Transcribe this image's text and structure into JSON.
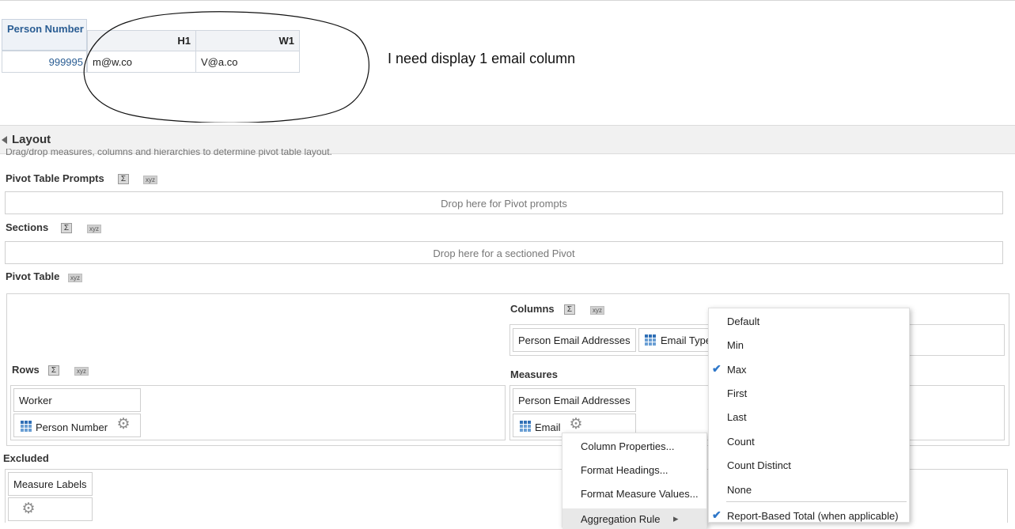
{
  "preview": {
    "row_header": "Person Number",
    "col_headers": [
      "H1",
      "W1"
    ],
    "row_value": "999995",
    "cells": [
      "m@w.co",
      "V@a.co"
    ],
    "note": "I need display 1 email column"
  },
  "layout": {
    "title": "Layout",
    "hint": "Drag/drop measures, columns and hierarchies to determine pivot table layout.",
    "sigma": "Σ",
    "xyz": "xyz",
    "pivot_prompts_label": "Pivot Table Prompts",
    "pivot_prompts_drop": "Drop here for Pivot prompts",
    "sections_label": "Sections",
    "sections_drop": "Drop here for a sectioned Pivot",
    "pivot_table_label": "Pivot Table",
    "columns_label": "Columns",
    "columns_chips": [
      "Person Email Addresses",
      "Email Type"
    ],
    "rows_label": "Rows",
    "rows_chips": [
      "Worker",
      "Person Number"
    ],
    "measures_label": "Measures",
    "measures_chips": [
      "Person Email Addresses",
      "Email"
    ],
    "excluded_label": "Excluded",
    "excluded_chips": [
      "Measure Labels"
    ]
  },
  "context_menu": {
    "items": [
      "Column Properties...",
      "Format Headings...",
      "Format Measure Values...",
      "Aggregation Rule"
    ],
    "submenu_arrow": "▸"
  },
  "aggregation_menu": {
    "items": [
      "Default",
      "Min",
      "Max",
      "First",
      "Last",
      "Count",
      "Count Distinct",
      "None",
      "Report-Based Total (when applicable)"
    ],
    "checked": [
      "Max",
      "Report-Based Total (when applicable)"
    ],
    "check_color": "#2e77c9"
  }
}
